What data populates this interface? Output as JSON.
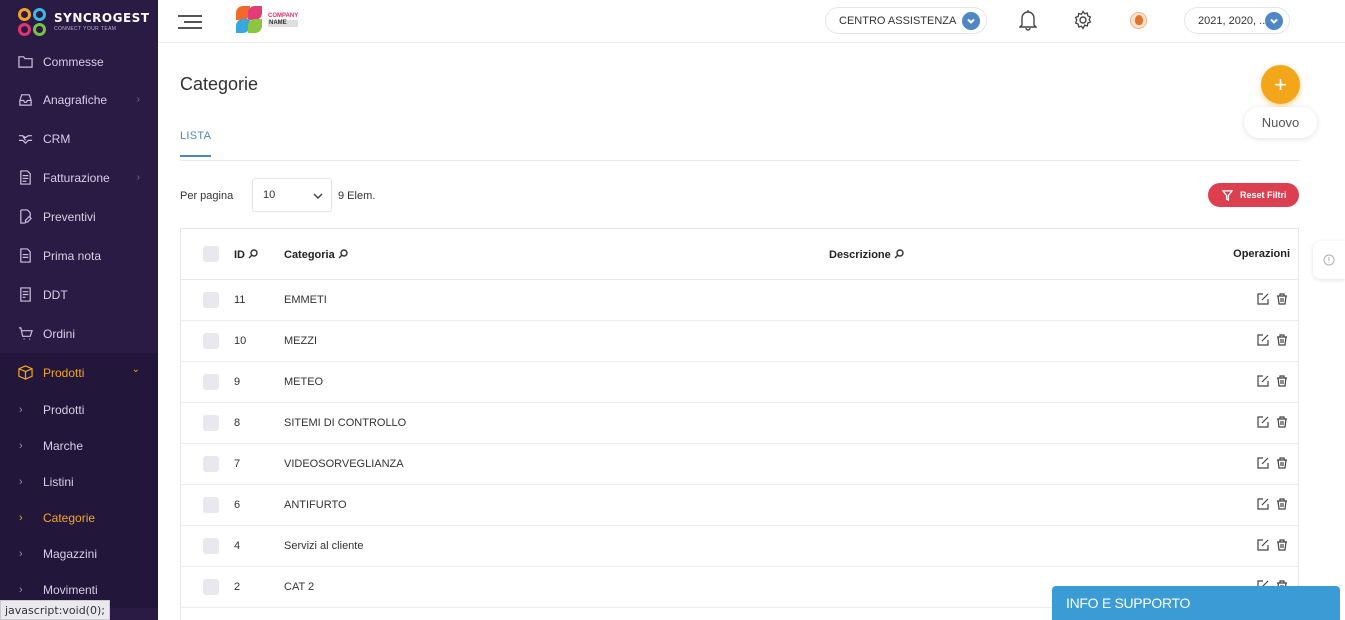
{
  "brand": {
    "name": "SYNCROGEST",
    "tagline": "CONNECT YOUR TEAM"
  },
  "company_logo": {
    "line1": "COMPANY",
    "line2": "NAME"
  },
  "topbar": {
    "assist_label": "CENTRO ASSISTENZA",
    "year_label": "2021, 2020, ..."
  },
  "sidebar": {
    "items": [
      {
        "label": "Commesse",
        "icon": "folder-icon"
      },
      {
        "label": "Anagrafiche",
        "icon": "inbox-icon",
        "arrow": "›"
      },
      {
        "label": "CRM",
        "icon": "handshake-icon"
      },
      {
        "label": "Fatturazione",
        "icon": "document-icon",
        "arrow": "›"
      },
      {
        "label": "Preventivi",
        "icon": "edit-document-icon"
      },
      {
        "label": "Prima nota",
        "icon": "note-icon"
      },
      {
        "label": "DDT",
        "icon": "ddt-icon"
      },
      {
        "label": "Ordini",
        "icon": "cart-icon"
      },
      {
        "label": "Prodotti",
        "icon": "box-icon",
        "arrow": "⌄"
      }
    ],
    "sub_items": [
      {
        "label": "Prodotti"
      },
      {
        "label": "Marche"
      },
      {
        "label": "Listini"
      },
      {
        "label": "Categorie"
      },
      {
        "label": "Magazzini"
      },
      {
        "label": "Movimenti"
      }
    ]
  },
  "statusbar": {
    "text": "javascript:void(0);"
  },
  "page": {
    "title": "Categorie",
    "new_label": "Nuovo",
    "new_icon": "+",
    "tab_label": "LISTA"
  },
  "filters": {
    "per_page_label": "Per pagina",
    "per_page_value": "10",
    "count_label": "9 Elem.",
    "reset_label": "Reset Filtri"
  },
  "table": {
    "headers": {
      "id": "ID",
      "category": "Categoria",
      "description": "Descrizione",
      "operations": "Operazioni"
    },
    "rows": [
      {
        "id": "11",
        "category": "EMMETI",
        "description": ""
      },
      {
        "id": "10",
        "category": "MEZZI",
        "description": ""
      },
      {
        "id": "9",
        "category": "METEO",
        "description": ""
      },
      {
        "id": "8",
        "category": "SITEMI DI CONTROLLO",
        "description": ""
      },
      {
        "id": "7",
        "category": "VIDEOSORVEGLIANZA",
        "description": ""
      },
      {
        "id": "6",
        "category": "ANTIFURTO",
        "description": ""
      },
      {
        "id": "4",
        "category": "Servizi al cliente",
        "description": ""
      },
      {
        "id": "2",
        "category": "CAT 2",
        "description": ""
      }
    ]
  },
  "info_box": {
    "label": "INFO E SUPPORTO"
  },
  "colors": {
    "sidebar_bg": "#2a1b45",
    "accent_orange": "#f4a61b",
    "primary_blue": "#4f86c6",
    "danger_red": "#dc4050",
    "info_blue": "#3a9bd5"
  }
}
